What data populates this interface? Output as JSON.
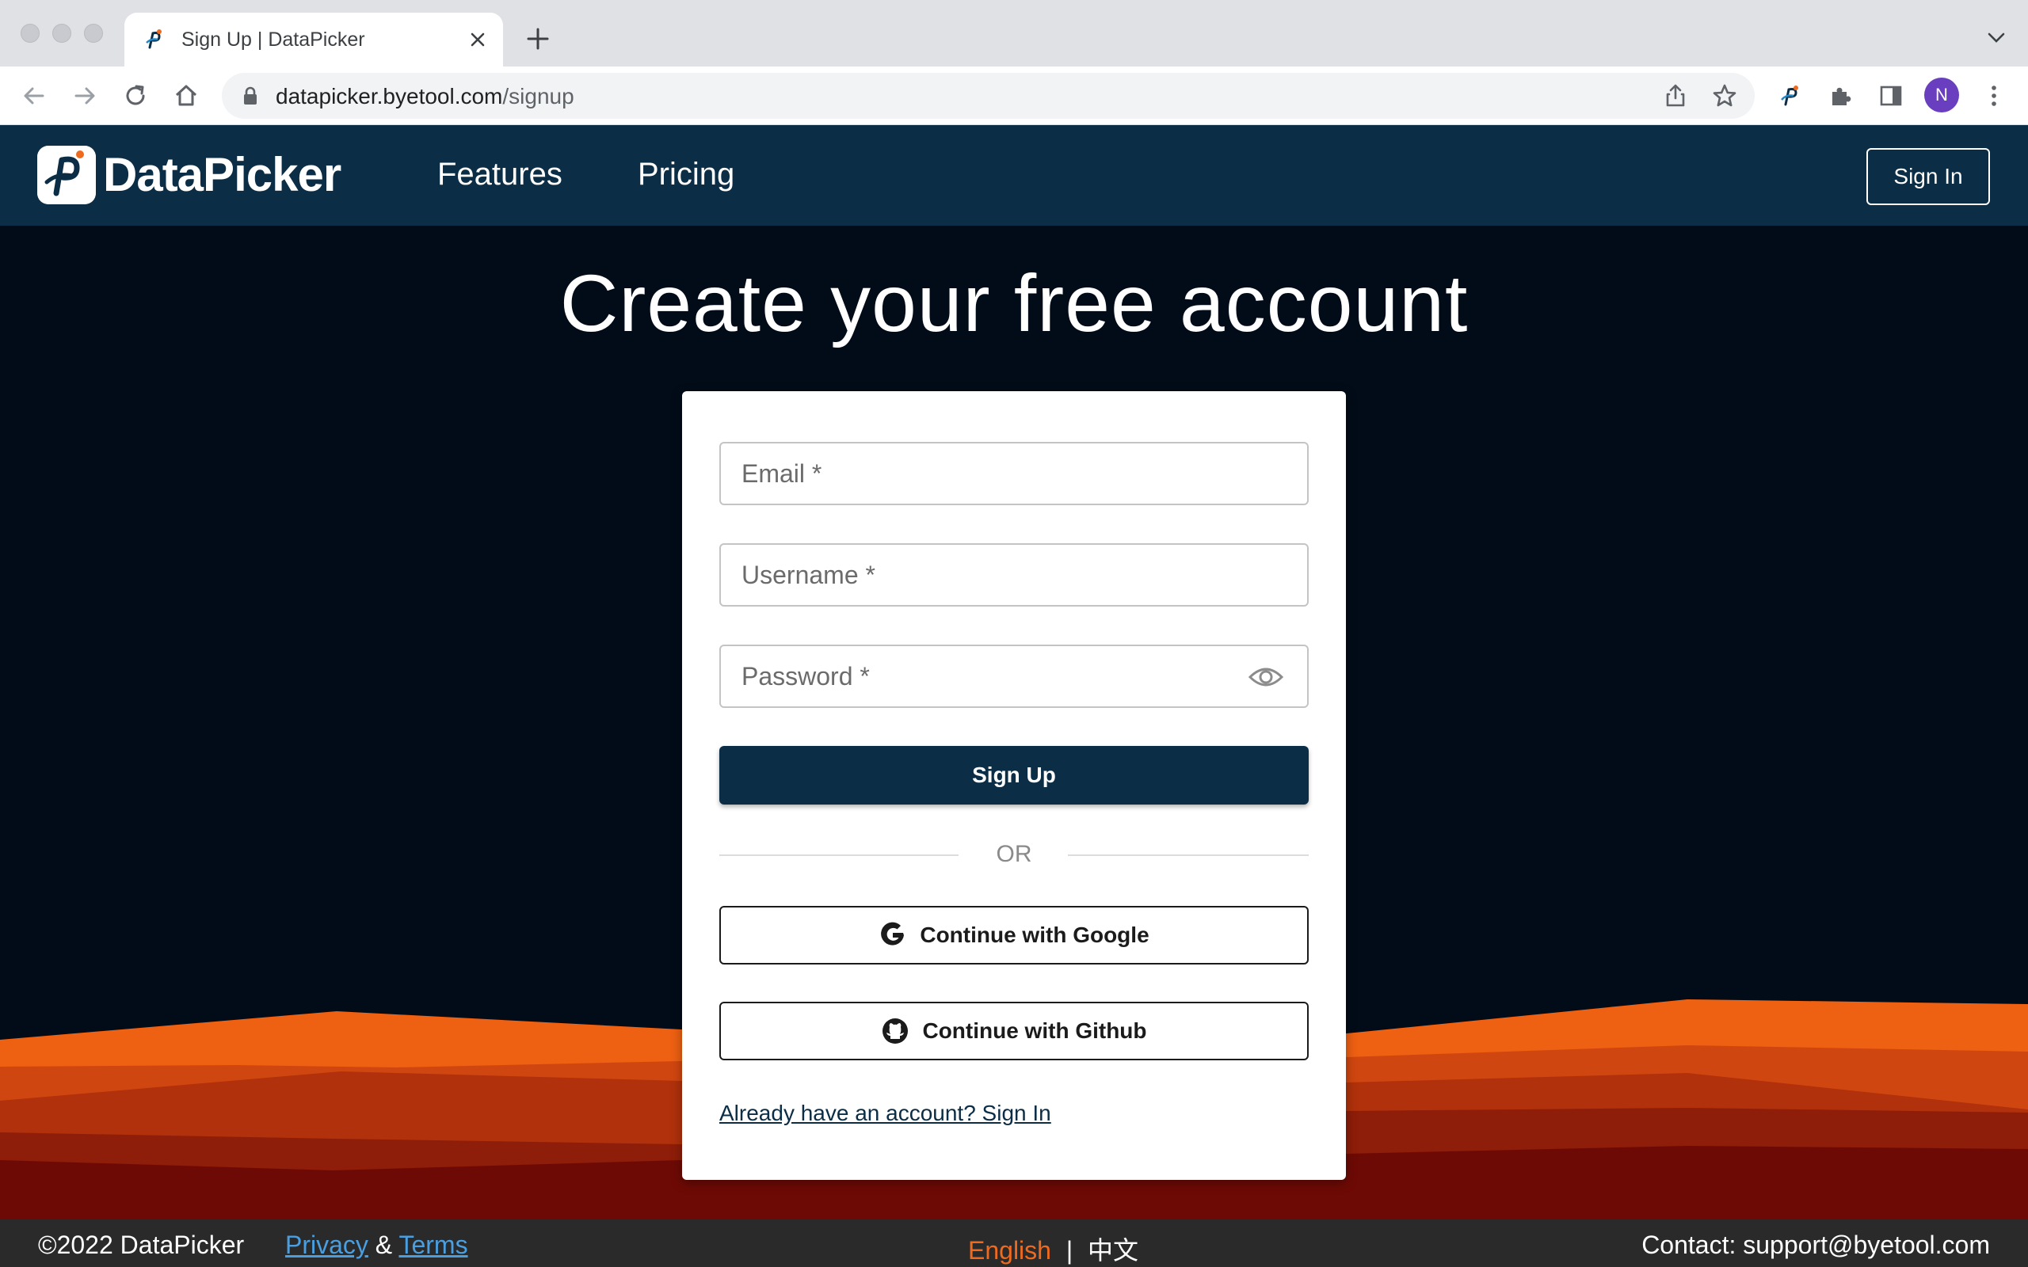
{
  "browser": {
    "tab_title": "Sign Up | DataPicker",
    "url_host": "datapicker.byetool.com",
    "url_path": "/signup",
    "profile_initial": "N"
  },
  "header": {
    "logo_text": "DataPicker",
    "nav": [
      "Features",
      "Pricing"
    ],
    "signin_label": "Sign In",
    "bg_color": "#0b2d45"
  },
  "hero": {
    "title": "Create your free account"
  },
  "form": {
    "email_label": "Email *",
    "username_label": "Username *",
    "password_label": "Password *",
    "signup_label": "Sign Up",
    "or_text": "OR",
    "google_label": "Continue with Google",
    "github_label": "Continue with Github",
    "signin_link": "Already have an account? Sign In"
  },
  "footer": {
    "copyright": "©2022 DataPicker",
    "privacy": "Privacy",
    "amp": "&",
    "terms": "Terms",
    "lang_en": "English",
    "lang_sep": "|",
    "lang_zh": "中文",
    "contact": "Contact: support@byetool.com"
  },
  "colors": {
    "accent": "#0b2d45",
    "orange": "#ee6a1f",
    "link": "#4a9fe0"
  }
}
